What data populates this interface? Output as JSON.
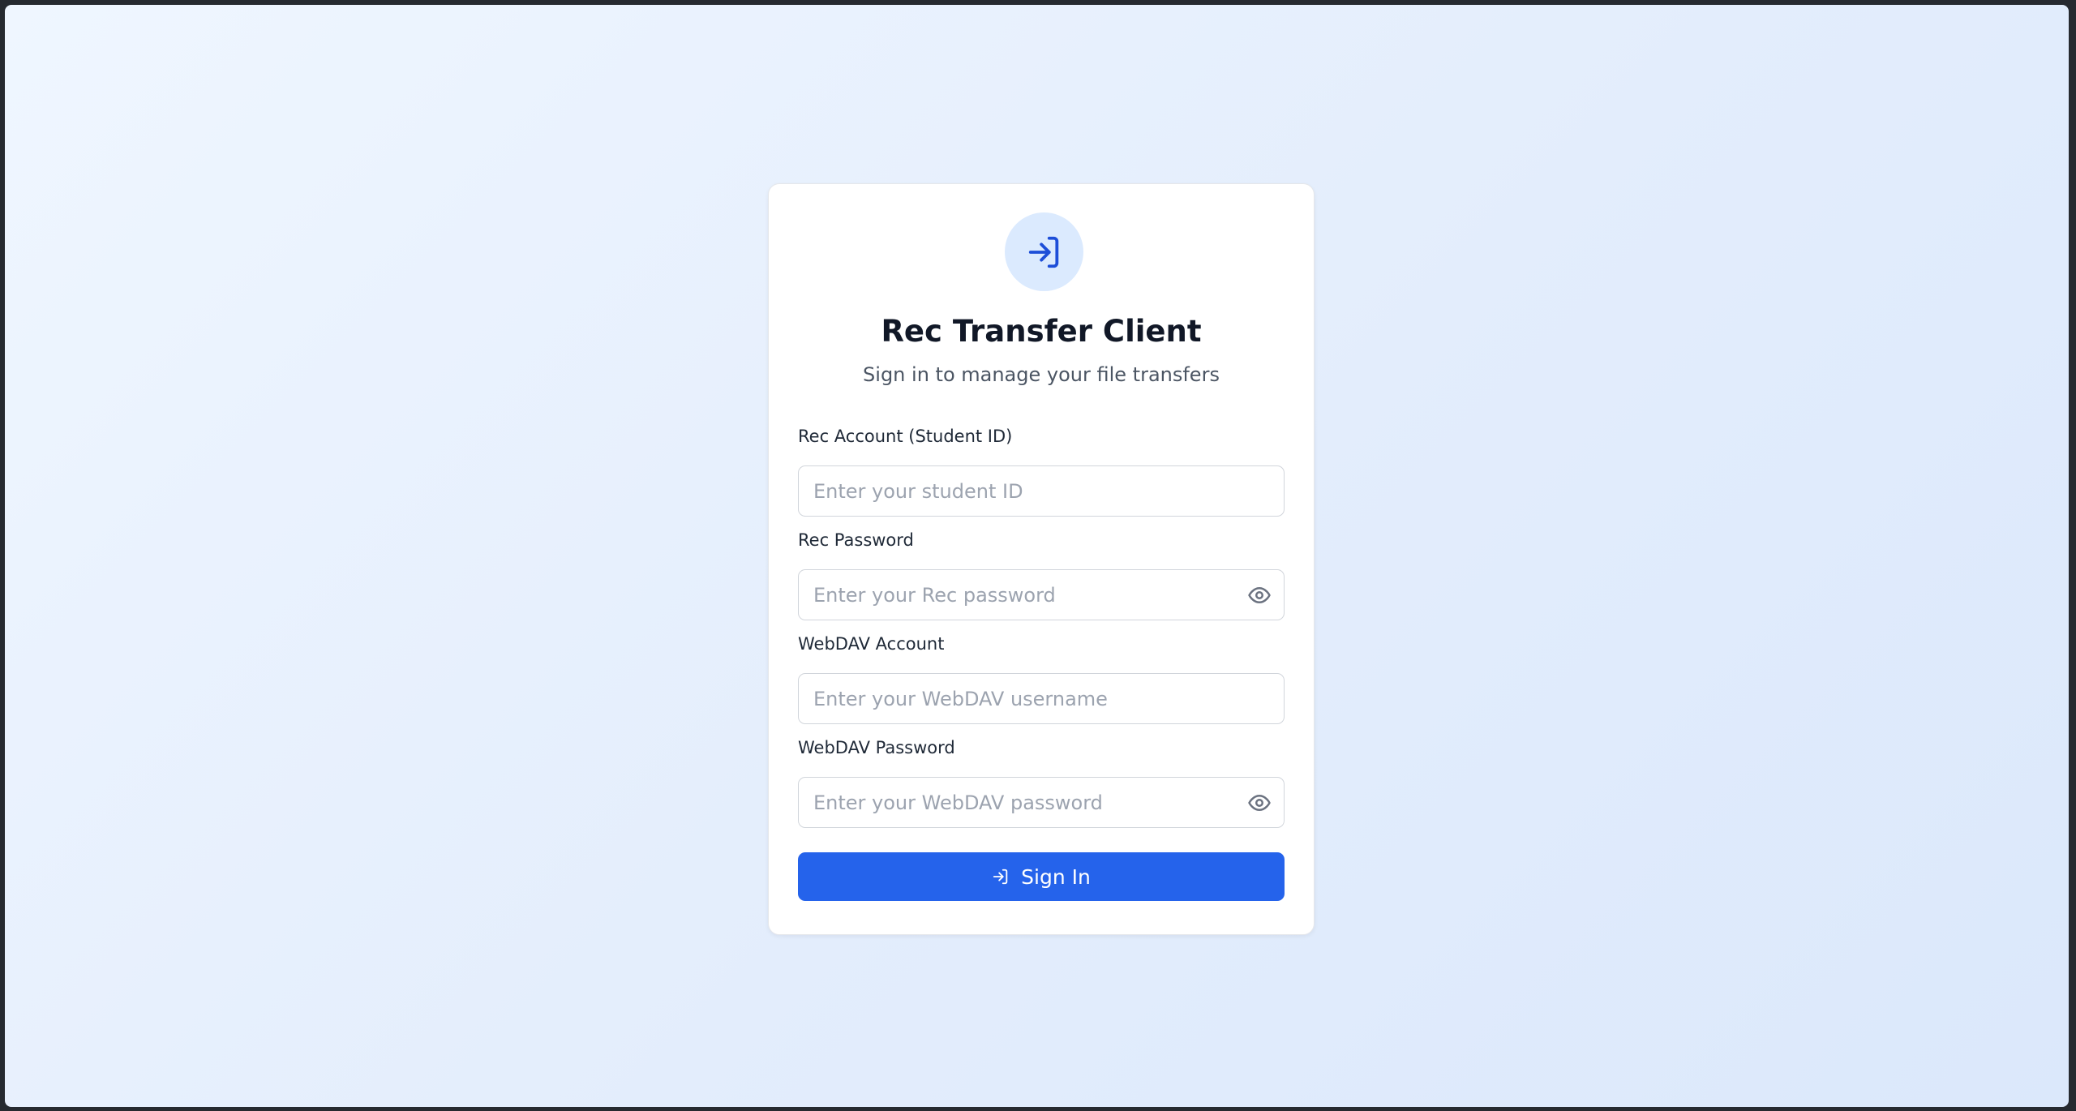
{
  "app": {
    "title": "Rec Transfer Client",
    "subtitle": "Sign in to manage your file transfers",
    "logo_icon": "sign-in-arrow-icon"
  },
  "form": {
    "rec_account": {
      "label": "Rec Account (Student ID)",
      "placeholder": "Enter your student ID",
      "value": ""
    },
    "rec_password": {
      "label": "Rec Password",
      "placeholder": "Enter your Rec password",
      "value": "",
      "toggle_icon": "eye-icon"
    },
    "webdav_account": {
      "label": "WebDAV Account",
      "placeholder": "Enter your WebDAV username",
      "value": ""
    },
    "webdav_password": {
      "label": "WebDAV Password",
      "placeholder": "Enter your WebDAV password",
      "value": "",
      "toggle_icon": "eye-icon"
    },
    "submit": {
      "label": "Sign In",
      "icon": "sign-in-arrow-icon"
    }
  },
  "colors": {
    "accent": "#2563eb",
    "icon_bg": "#dbeafe",
    "icon_fg": "#1d4ed8",
    "muted_icon": "#6b7280",
    "background_start": "#eff6ff",
    "background_end": "#dbe8fb"
  }
}
